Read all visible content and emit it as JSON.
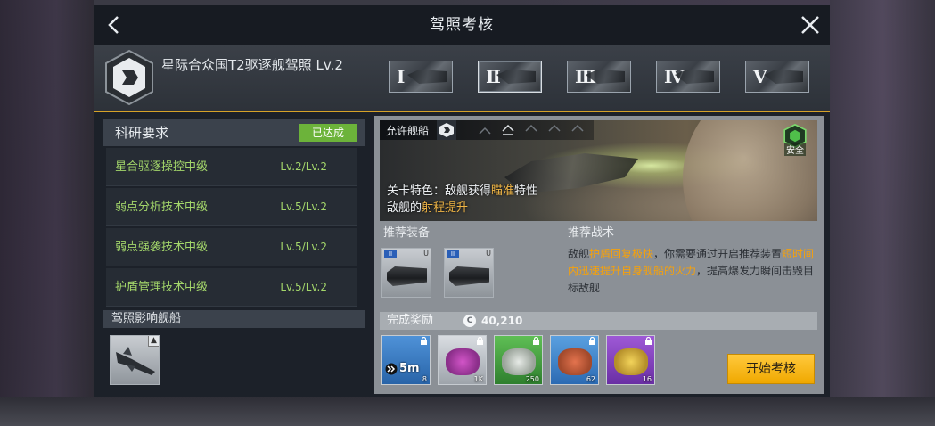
{
  "dialog": {
    "title": "驾照考核"
  },
  "license": {
    "name": "星际合众国T2驱逐舰驾照 Lv.2",
    "tiers": [
      "Ⅰ",
      "Ⅱ",
      "Ⅲ",
      "Ⅳ",
      "Ⅴ"
    ],
    "active_tier_index": 1
  },
  "research": {
    "title": "科研要求",
    "status": "已达成",
    "items": [
      {
        "name": "星合驱逐操控中级",
        "level": "Lv.2/Lv.2"
      },
      {
        "name": "弱点分析技术中级",
        "level": "Lv.5/Lv.2"
      },
      {
        "name": "弱点强袭技术中级",
        "level": "Lv.5/Lv.2"
      },
      {
        "name": "护盾管理技术中级",
        "level": "Lv.5/Lv.2"
      }
    ]
  },
  "influence": {
    "title": "驾照影响舰船"
  },
  "stage": {
    "allowed_label": "允许舰船",
    "safe_label": "安全",
    "feature_prefix": "关卡特色：敌舰获得",
    "feature_highlight": "瞄准",
    "feature_suffix": "特性",
    "range_prefix": "敌舰的",
    "range_highlight": "射程提升"
  },
  "equipment": {
    "title": "推荐装备",
    "cards": [
      {
        "tier": "II",
        "mark": "U"
      },
      {
        "tier": "II",
        "mark": "U"
      }
    ]
  },
  "tactics": {
    "title": "推荐战术",
    "p1": "敌舰",
    "h1": "护盾回复极快",
    "p2": "，你需要通过开启推荐装置",
    "h2": "短时间内迅速提升自身舰船的火力",
    "p3": "，提高爆发力瞬间击毁目标敌舰"
  },
  "reward": {
    "title": "完成奖励",
    "coin_icon": "C",
    "amount": "40,210",
    "items": [
      {
        "type": "speedup",
        "time": "5m",
        "count": "8",
        "color": "r-blue"
      },
      {
        "type": "crystal",
        "count": "1K",
        "color": "r-white"
      },
      {
        "type": "crystal",
        "count": "250",
        "color": "r-green"
      },
      {
        "type": "crystal",
        "count": "62",
        "color": "r-blue2"
      },
      {
        "type": "crystal",
        "count": "16",
        "color": "r-purple"
      }
    ]
  },
  "actions": {
    "start_label": "开始考核"
  },
  "colors": {
    "accent": "#d6a228",
    "achieved": "#6cb33a",
    "highlight": "#f5a10c",
    "button": "#f0a800"
  }
}
